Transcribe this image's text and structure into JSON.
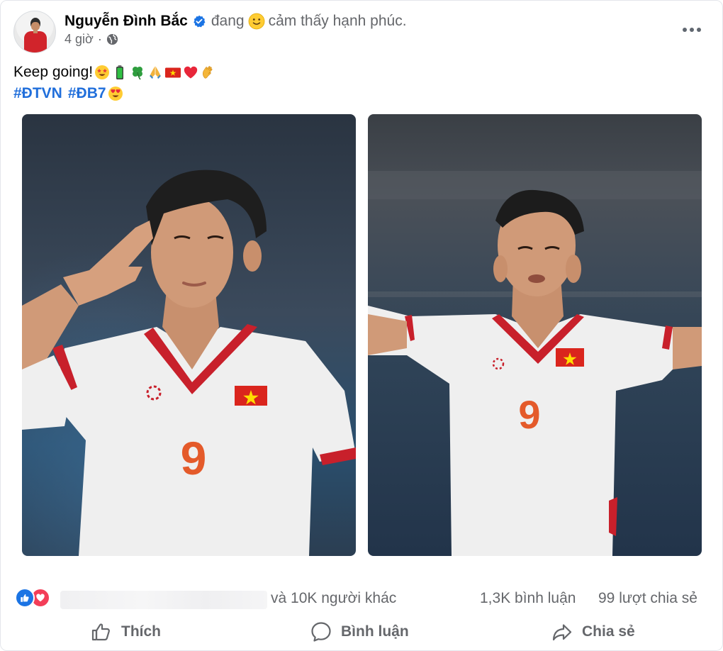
{
  "post": {
    "author": "Nguyễn Đình Bắc",
    "feeling_prefix": "đang",
    "feeling_text": "cảm thấy hạnh phúc.",
    "time": "4 giờ",
    "meta_dot": "·",
    "text_line1": "Keep going!",
    "hashtags": [
      "#ĐTVN",
      "#ĐB7"
    ],
    "photo_jersey_number": "9",
    "emojis": [
      "star-struck-emoji",
      "battery-emoji",
      "four-leaf-clover-emoji",
      "folded-hands-emoji",
      "vietnam-flag-emoji",
      "red-heart-emoji",
      "clapping-hands-emoji"
    ]
  },
  "reactions": {
    "others_text": "và 10K người khác",
    "comments": "1,3K bình luận",
    "shares": "99 lượt chia sẻ"
  },
  "actions": {
    "like": "Thích",
    "comment": "Bình luận",
    "share": "Chia sẻ"
  },
  "colors": {
    "link_blue": "#216fdb",
    "secondary_text": "#65676b",
    "like_blue": "#1b74e4",
    "love_red": "#f33e58",
    "jersey_red": "#d1242b"
  }
}
